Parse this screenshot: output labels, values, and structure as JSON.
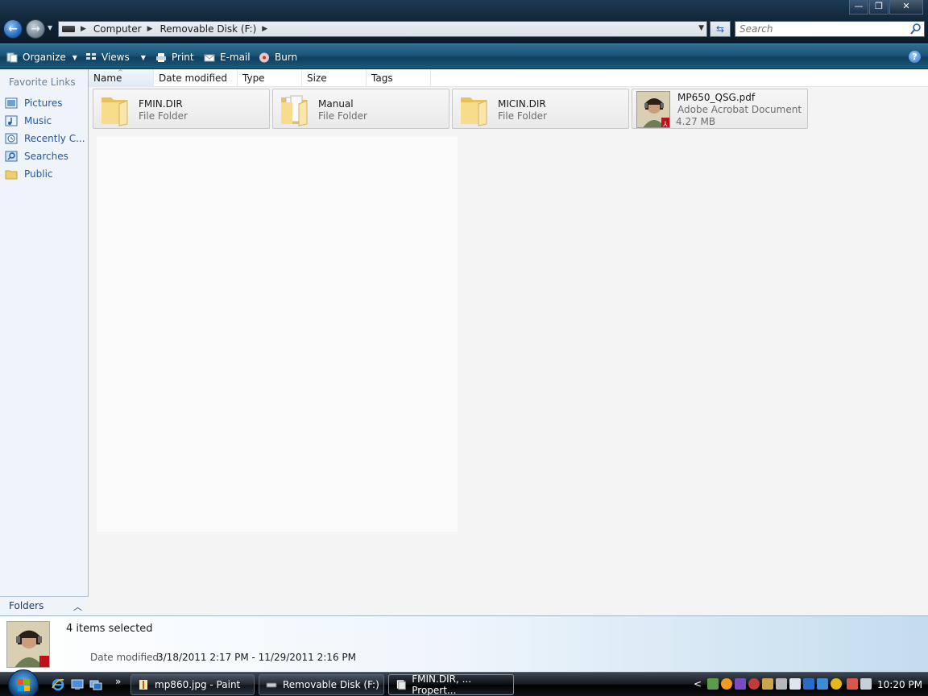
{
  "window": {
    "minimize": "—",
    "restore": "❐",
    "close": "✕"
  },
  "address_bar": {
    "breadcrumbs": [
      "Computer",
      "Removable Disk (F:)"
    ],
    "search_placeholder": "Search"
  },
  "toolbar": {
    "organize": "Organize",
    "views": "Views",
    "print": "Print",
    "email": "E-mail",
    "burn": "Burn",
    "help": "?"
  },
  "nav_pane": {
    "favorite_links_title": "Favorite Links",
    "items": [
      {
        "label": "Pictures",
        "icon": "pictures-icon"
      },
      {
        "label": "Music",
        "icon": "music-icon"
      },
      {
        "label": "Recently C...",
        "icon": "recent-icon"
      },
      {
        "label": "Searches",
        "icon": "searches-icon"
      },
      {
        "label": "Public",
        "icon": "folder-icon"
      }
    ],
    "folders_label": "Folders"
  },
  "columns": [
    "Name",
    "Date modified",
    "Type",
    "Size",
    "Tags"
  ],
  "files": [
    {
      "name": "FMIN.DIR",
      "type": "File Folder"
    },
    {
      "name": "Manual",
      "type": "File Folder"
    },
    {
      "name": "MICIN.DIR",
      "type": "File Folder"
    },
    {
      "name": "MP650_QSG.pdf",
      "type": "Adobe Acrobat Document",
      "size": "4.27 MB"
    }
  ],
  "details": {
    "selected_count": "4 items selected",
    "date_label": "Date modified:",
    "date_value": "3/18/2011 2:17 PM - 11/29/2011 2:16 PM"
  },
  "taskbar": {
    "quick_launch_more": "»",
    "buttons": [
      "mp860.jpg - Paint",
      "Removable Disk (F:)",
      "FMIN.DIR, ... Propert..."
    ],
    "tray_arrow": "<",
    "clock": "10:20 PM"
  }
}
